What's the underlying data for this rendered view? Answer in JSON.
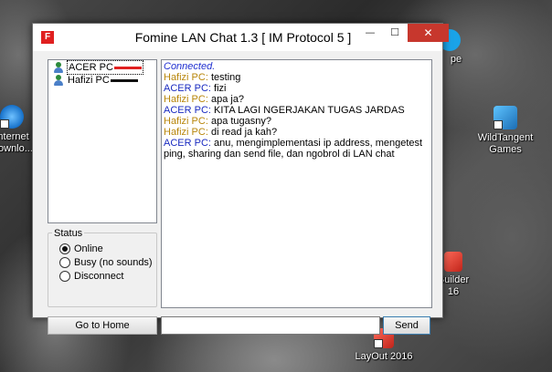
{
  "desktop": {
    "icons": [
      {
        "label_line1": "Internet",
        "label_line2": "Downlo...",
        "icon": "ie-icon"
      },
      {
        "label_line1": "WildTangent",
        "label_line2": "Games",
        "icon": "wildtangent-icon"
      },
      {
        "label_line1": "Builder",
        "label_line2": "16",
        "icon": "builder-icon"
      },
      {
        "label_line1": "LayOut 2016",
        "label_line2": "",
        "icon": "layout-icon"
      },
      {
        "label_line1": "pe",
        "label_line2": "",
        "icon": "skype-icon"
      }
    ]
  },
  "window": {
    "app_icon_letter": "F",
    "title": "Fomine LAN Chat 1.3   [ IM Protocol 5 ]",
    "controls": {
      "minimize": "—",
      "maximize": "☐",
      "close": "✕"
    }
  },
  "users": [
    {
      "name": "ACER PC",
      "mark_color": "#e02020",
      "selected": true
    },
    {
      "name": "Hafizi PC",
      "mark_color": "#111111",
      "selected": false
    }
  ],
  "status": {
    "legend": "Status",
    "options": [
      {
        "label": "Online",
        "checked": true
      },
      {
        "label": "Busy (no sounds)",
        "checked": false
      },
      {
        "label": "Disconnect",
        "checked": false
      }
    ]
  },
  "buttons": {
    "home": "Go to Home",
    "send": "Send"
  },
  "input": {
    "value": ""
  },
  "chat": {
    "connected": "Connected.",
    "messages": [
      {
        "speaker": "Hafizi PC:",
        "text": " testing",
        "kind": "hafizi"
      },
      {
        "speaker": "ACER PC:",
        "text": " fizi",
        "kind": "acer"
      },
      {
        "speaker": "Hafizi PC:",
        "text": " apa ja?",
        "kind": "hafizi"
      },
      {
        "speaker": "ACER PC:",
        "text": " KITA LAGI NGERJAKAN TUGAS JARDAS",
        "kind": "acer"
      },
      {
        "speaker": "Hafizi PC:",
        "text": " apa tugasny?",
        "kind": "hafizi"
      },
      {
        "speaker": "Hafizi PC:",
        "text": " di read ja kah?",
        "kind": "hafizi"
      },
      {
        "speaker": "ACER PC:",
        "text": " anu, mengimplementasi ip address, mengetest ping, sharing dan send file, dan ngobrol di LAN chat",
        "kind": "acer"
      }
    ]
  },
  "colors": {
    "hafizi": "#b8860b",
    "acer": "#1a2bc0",
    "close_button": "#c7372d"
  }
}
